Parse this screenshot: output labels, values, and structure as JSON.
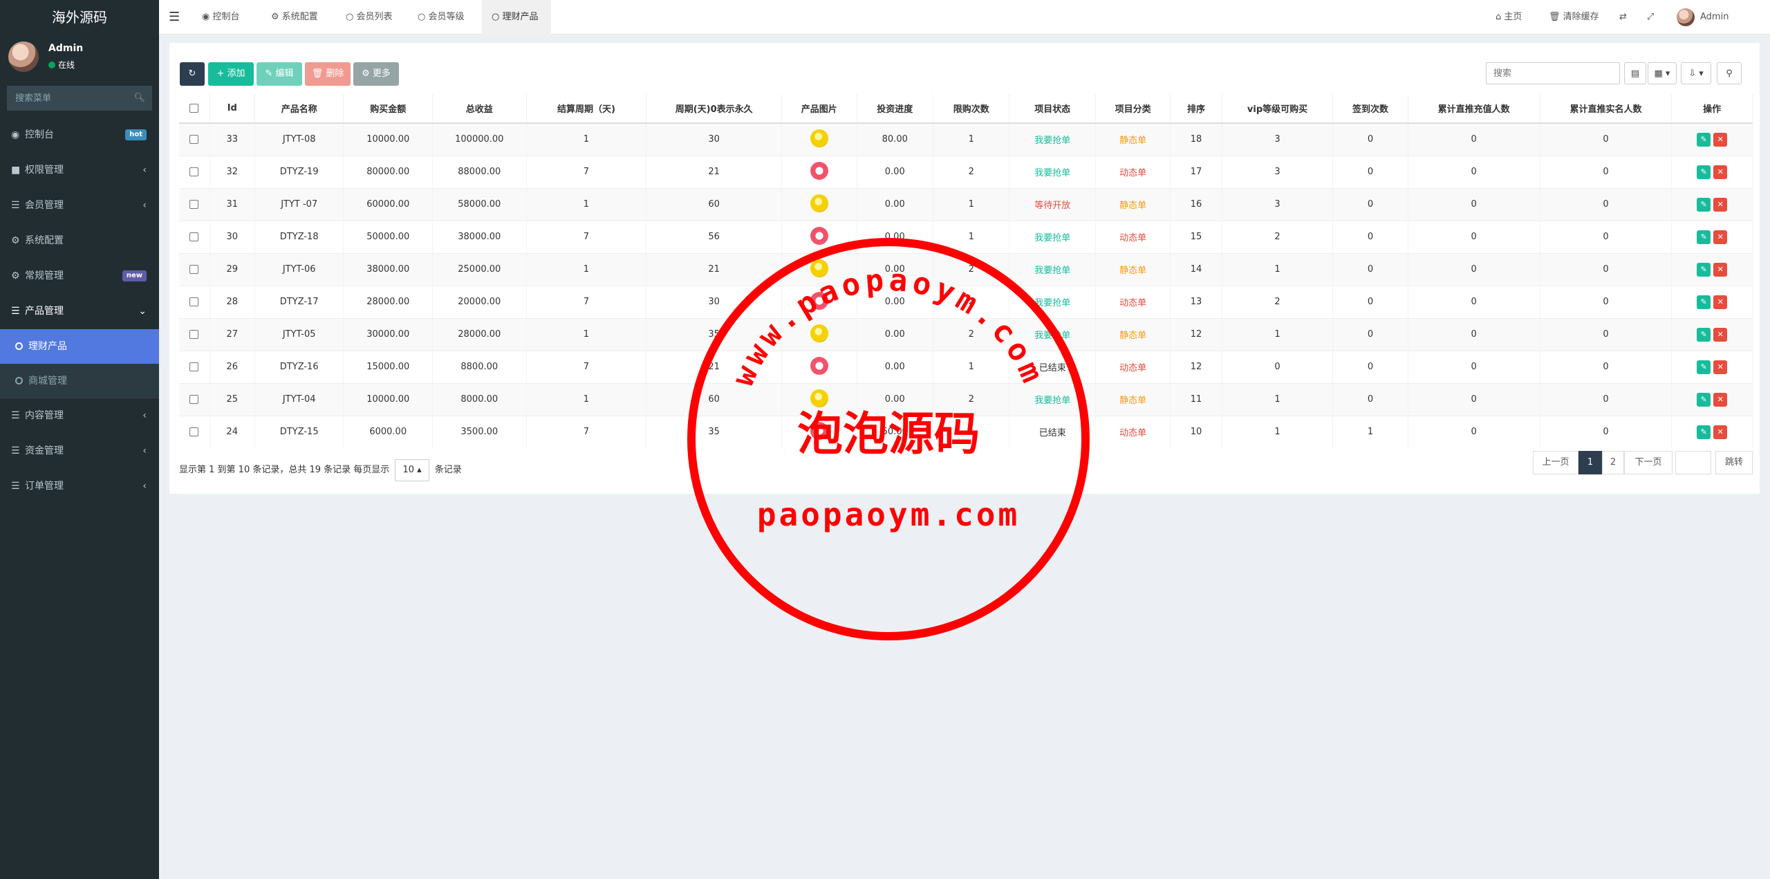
{
  "sidebar": {
    "logo": "海外源码",
    "user": {
      "name": "Admin",
      "status": "在线"
    },
    "search_placeholder": "搜索菜单",
    "items": [
      {
        "label": "控制台",
        "badge": "hot",
        "badge_color": "#3c8dbc"
      },
      {
        "label": "权限管理"
      },
      {
        "label": "会员管理"
      },
      {
        "label": "系统配置"
      },
      {
        "label": "常规管理",
        "badge": "new",
        "badge_color": "#605ca8"
      },
      {
        "label": "产品管理"
      },
      {
        "label": "内容管理"
      },
      {
        "label": "资金管理"
      },
      {
        "label": "订单管理"
      }
    ],
    "sub_items": [
      {
        "label": "理财产品"
      },
      {
        "label": "商城管理"
      }
    ]
  },
  "topbar": {
    "tabs": [
      {
        "label": "控制台"
      },
      {
        "label": "系统配置"
      },
      {
        "label": "会员列表"
      },
      {
        "label": "会员等级"
      },
      {
        "label": "理财产品"
      }
    ],
    "home": "主页",
    "clear_cache": "清除缓存",
    "admin": "Admin"
  },
  "toolbar": {
    "add": "添加",
    "edit": "编辑",
    "delete": "删除",
    "more": "更多",
    "search_placeholder": "搜索"
  },
  "table": {
    "columns": [
      "Id",
      "产品名称",
      "购买金额",
      "总收益",
      "结算周期（天)",
      "周期(天)0表示永久",
      "产品图片",
      "投资进度",
      "限购次数",
      "项目状态",
      "项目分类",
      "排序",
      "vip等级可购买",
      "签到次数",
      "累计直推充值人数",
      "累计直推实名人数",
      "操作"
    ],
    "rows": [
      {
        "id": "33",
        "name": "JTYT-08",
        "amount": "10000.00",
        "income": "100000.00",
        "settle": "1",
        "period": "30",
        "img": "coin",
        "progress": "80.00",
        "limit": "1",
        "status": "我要抢单",
        "category": "静态单",
        "sort": "18",
        "vip": "3",
        "sign": "0",
        "recharge": "0",
        "realname": "0"
      },
      {
        "id": "32",
        "name": "DTYZ-19",
        "amount": "80000.00",
        "income": "88000.00",
        "settle": "7",
        "period": "21",
        "img": "red",
        "progress": "0.00",
        "limit": "2",
        "status": "我要抢单",
        "category": "动态单",
        "sort": "17",
        "vip": "3",
        "sign": "0",
        "recharge": "0",
        "realname": "0"
      },
      {
        "id": "31",
        "name": "JTYT -07",
        "amount": "60000.00",
        "income": "58000.00",
        "settle": "1",
        "period": "60",
        "img": "coin",
        "progress": "0.00",
        "limit": "1",
        "status": "等待开放",
        "category": "静态单",
        "sort": "16",
        "vip": "3",
        "sign": "0",
        "recharge": "0",
        "realname": "0"
      },
      {
        "id": "30",
        "name": "DTYZ-18",
        "amount": "50000.00",
        "income": "38000.00",
        "settle": "7",
        "period": "56",
        "img": "red",
        "progress": "0.00",
        "limit": "1",
        "status": "我要抢单",
        "category": "动态单",
        "sort": "15",
        "vip": "2",
        "sign": "0",
        "recharge": "0",
        "realname": "0"
      },
      {
        "id": "29",
        "name": "JTYT-06",
        "amount": "38000.00",
        "income": "25000.00",
        "settle": "1",
        "period": "21",
        "img": "coin",
        "progress": "0.00",
        "limit": "2",
        "status": "我要抢单",
        "category": "静态单",
        "sort": "14",
        "vip": "1",
        "sign": "0",
        "recharge": "0",
        "realname": "0"
      },
      {
        "id": "28",
        "name": "DTYZ-17",
        "amount": "28000.00",
        "income": "20000.00",
        "settle": "7",
        "period": "30",
        "img": "red",
        "progress": "0.00",
        "limit": "2",
        "status": "我要抢单",
        "category": "动态单",
        "sort": "13",
        "vip": "2",
        "sign": "0",
        "recharge": "0",
        "realname": "0"
      },
      {
        "id": "27",
        "name": "JTYT-05",
        "amount": "30000.00",
        "income": "28000.00",
        "settle": "1",
        "period": "35",
        "img": "coin",
        "progress": "0.00",
        "limit": "2",
        "status": "我要抢单",
        "category": "静态单",
        "sort": "12",
        "vip": "1",
        "sign": "0",
        "recharge": "0",
        "realname": "0"
      },
      {
        "id": "26",
        "name": "DTYZ-16",
        "amount": "15000.00",
        "income": "8800.00",
        "settle": "7",
        "period": "21",
        "img": "red",
        "progress": "0.00",
        "limit": "1",
        "status": "已结束",
        "category": "动态单",
        "sort": "12",
        "vip": "0",
        "sign": "0",
        "recharge": "0",
        "realname": "0"
      },
      {
        "id": "25",
        "name": "JTYT-04",
        "amount": "10000.00",
        "income": "8000.00",
        "settle": "1",
        "period": "60",
        "img": "coin",
        "progress": "0.00",
        "limit": "2",
        "status": "我要抢单",
        "category": "静态单",
        "sort": "11",
        "vip": "1",
        "sign": "0",
        "recharge": "0",
        "realname": "0"
      },
      {
        "id": "24",
        "name": "DTYZ-15",
        "amount": "6000.00",
        "income": "3500.00",
        "settle": "7",
        "period": "35",
        "img": "red",
        "progress": "50.00",
        "limit": "1",
        "status": "已结束",
        "category": "动态单",
        "sort": "10",
        "vip": "1",
        "sign": "1",
        "recharge": "0",
        "realname": "0"
      }
    ]
  },
  "footer": {
    "summary": "显示第 1 到第 10 条记录，总共 19 条记录 每页显示",
    "page_size": "10",
    "suffix": "条记录"
  },
  "pagination": {
    "prev": "上一页",
    "pages": [
      "1",
      "2"
    ],
    "next": "下一页",
    "jump": "跳转"
  },
  "watermark": {
    "top_arc": "www.paopaoym.com",
    "title": "泡泡源码",
    "bottom": "paopaoym.com"
  }
}
